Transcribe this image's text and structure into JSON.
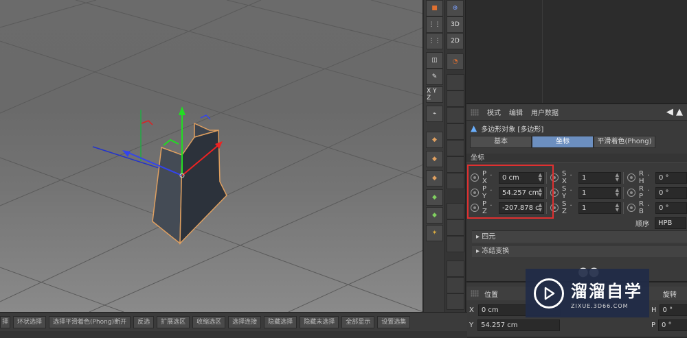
{
  "viewport": {},
  "bottom_toolbar": {
    "buttons": [
      "择",
      "环状选择",
      "选择平滑着色(Phong)断开",
      "反选",
      "扩展选区",
      "收缩选区",
      "选择连接",
      "隐藏选择",
      "隐藏未选择",
      "全部显示",
      "设置选集"
    ]
  },
  "toolbar": {
    "label_3d": "3D",
    "label_2d": "2D",
    "axis_label": "X Y Z"
  },
  "attributes": {
    "menu": [
      "模式",
      "编辑",
      "用户数据"
    ],
    "object_title": "多边形对象 [多边形]",
    "tabs": [
      "基本",
      "坐标",
      "平滑着色(Phong)"
    ],
    "active_tab": "坐标",
    "section": "坐标",
    "rows": [
      {
        "p_label": "P . X",
        "p_value": "0 cm",
        "s_label": "S . X",
        "s_value": "1",
        "r_label": "R . H",
        "r_value": "0 °"
      },
      {
        "p_label": "P . Y",
        "p_value": "54.257 cm",
        "s_label": "S . Y",
        "s_value": "1",
        "r_label": "R . P",
        "r_value": "0 °"
      },
      {
        "p_label": "P . Z",
        "p_value": "-207.878 c",
        "s_label": "S . Z",
        "s_value": "1",
        "r_label": "R . B",
        "r_value": "0 °"
      }
    ],
    "order_label": "顺序",
    "order_value": "HPB",
    "collapse_quaternion": "四元",
    "collapse_freeze": "冻结变换"
  },
  "coord_manager": {
    "position_label": "位置",
    "rotation_label": "旋转",
    "x_label": "X",
    "x_value": "0 cm",
    "y_label": "Y",
    "y_value": "54.257 cm",
    "h_label": "H",
    "h_value": "0 °",
    "p_label": "P",
    "p_value": "0 °"
  },
  "watermark": {
    "title": "溜溜自学",
    "subtitle": "ZIXUE.3D66.COM"
  },
  "colors": {
    "accent": "#6c8fc0",
    "highlight_box": "#e03030",
    "object_outline": "#e0a060"
  }
}
